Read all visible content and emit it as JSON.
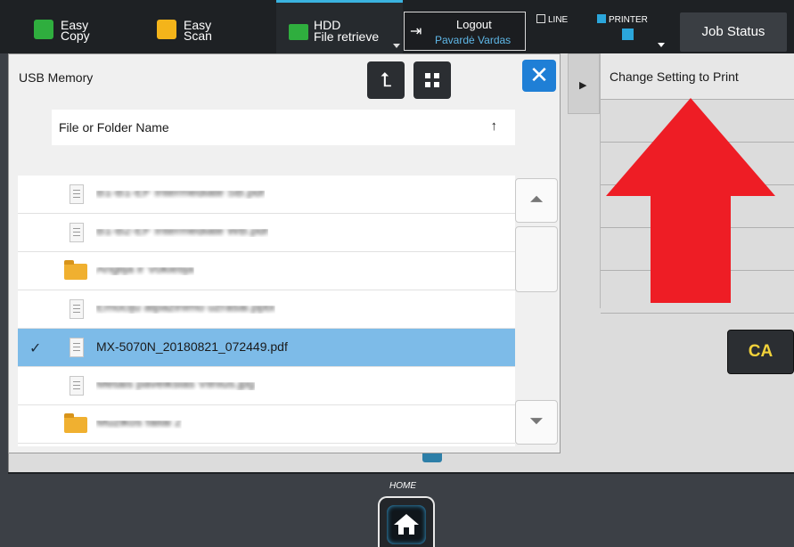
{
  "topbar": {
    "apps": [
      {
        "line1": "Easy",
        "line2": "Copy"
      },
      {
        "line1": "Easy",
        "line2": "Scan"
      },
      {
        "line1": "HDD",
        "line2": "File retrieve"
      }
    ],
    "logout": {
      "label": "Logout",
      "user": "Pavardė Vardas"
    },
    "status": {
      "line": "LINE",
      "printer": "PRINTER"
    },
    "job_status": "Job Status"
  },
  "dialog": {
    "title": "USB Memory",
    "close_glyph": "✕",
    "column_header": "File or Folder Name",
    "sort_glyph": "↑",
    "items": [
      {
        "type": "file",
        "name": "B1-B1-EF Intermediate SB.pdf",
        "selected": false
      },
      {
        "type": "file",
        "name": "B1-B2-EF Intermediate WB.pdf",
        "selected": false
      },
      {
        "type": "folder",
        "name": "Anglija ir Vokietija",
        "selected": false
      },
      {
        "type": "file",
        "name": "Emociju atpažinimo užrašai.pptx",
        "selected": false
      },
      {
        "type": "file",
        "name": "MX-5070N_20180821_072449.pdf",
        "selected": true
      },
      {
        "type": "file",
        "name": "Metais paveikslas Vilnius.jpg",
        "selected": false
      },
      {
        "type": "folder",
        "name": "Muzikos failai 2",
        "selected": false
      }
    ]
  },
  "settings": {
    "title": "Change Setting to Print"
  },
  "ca_button": "CA",
  "home": {
    "label": "HOME"
  },
  "colors": {
    "accent_blue": "#1f7fd6",
    "selection": "#7dbbe8",
    "annotation_red": "#ee1d25",
    "ca_text": "#f2d23a"
  },
  "icons": [
    "copy-icon",
    "scan-icon",
    "hdd-icon",
    "logout-icon",
    "printer-icon",
    "up-folder-icon",
    "grid-view-icon",
    "close-icon",
    "sort-up-icon",
    "document-icon",
    "folder-icon",
    "check-icon",
    "scroll-up-icon",
    "scroll-down-icon",
    "home-icon",
    "red-arrow-annotation"
  ]
}
